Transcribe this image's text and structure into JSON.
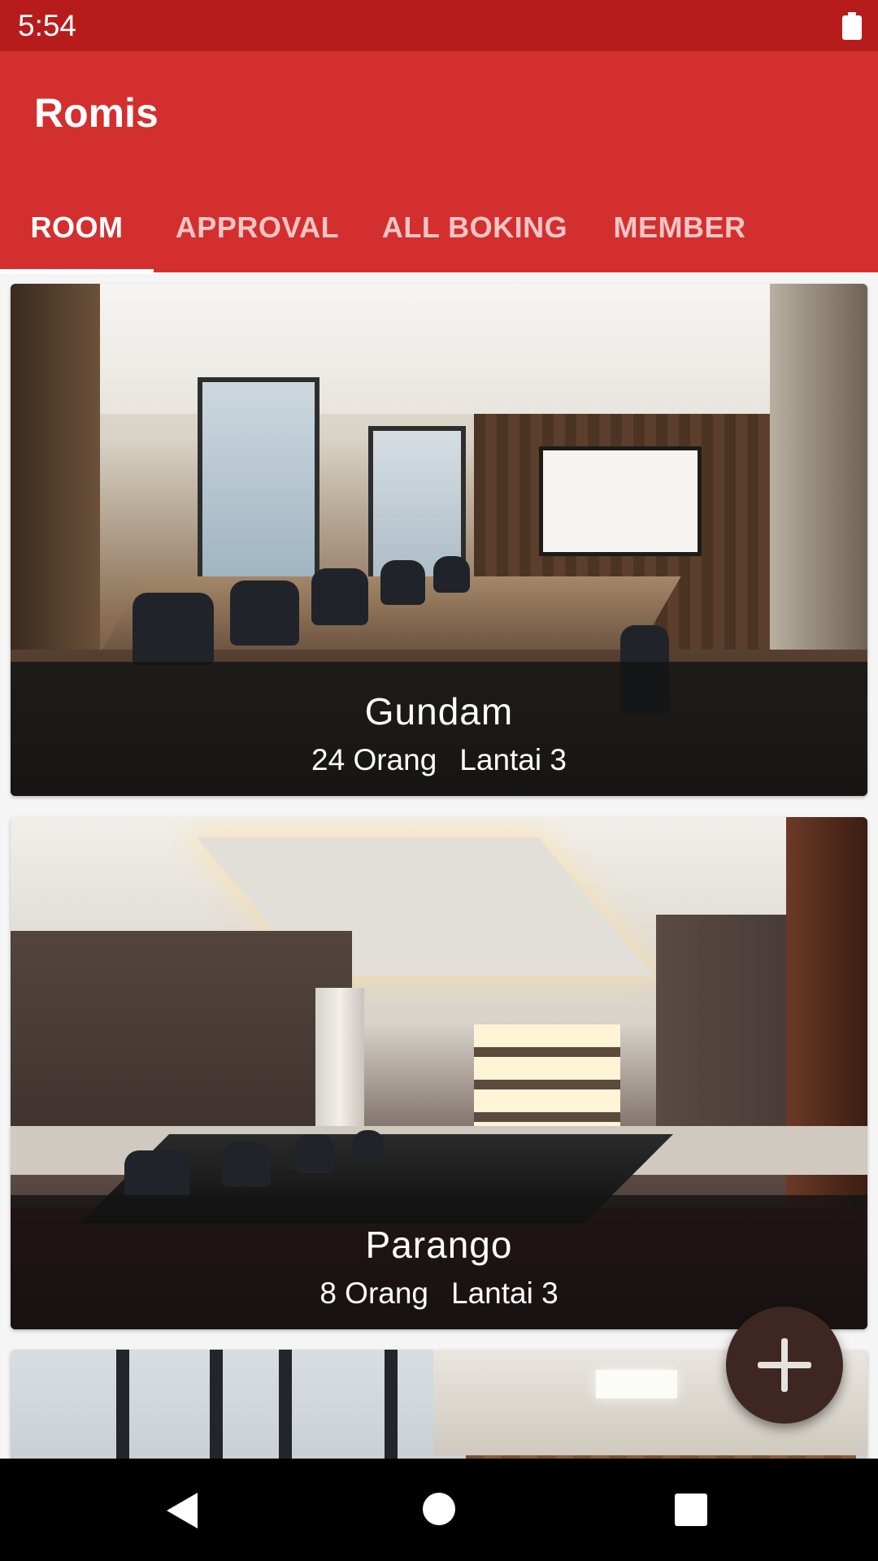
{
  "status_bar": {
    "time": "5:54"
  },
  "app_bar": {
    "title": "Romis"
  },
  "tabs": [
    {
      "label": "ROOM",
      "active": true
    },
    {
      "label": "APPROVAL",
      "active": false
    },
    {
      "label": "ALL BOKING",
      "active": false
    },
    {
      "label": "MEMBER",
      "active": false
    }
  ],
  "rooms": [
    {
      "name": "Gundam",
      "capacity": "24 Orang",
      "floor": "Lantai 3"
    },
    {
      "name": "Parango",
      "capacity": "8 Orang",
      "floor": "Lantai 3"
    }
  ],
  "fab": {
    "icon": "plus-icon"
  },
  "nav_bar": {
    "icons": [
      "back-icon",
      "home-icon",
      "recents-icon"
    ]
  },
  "colors": {
    "status_bar": "#b71c1c",
    "app_bar": "#d32f2f",
    "fab": "#3e2723"
  }
}
